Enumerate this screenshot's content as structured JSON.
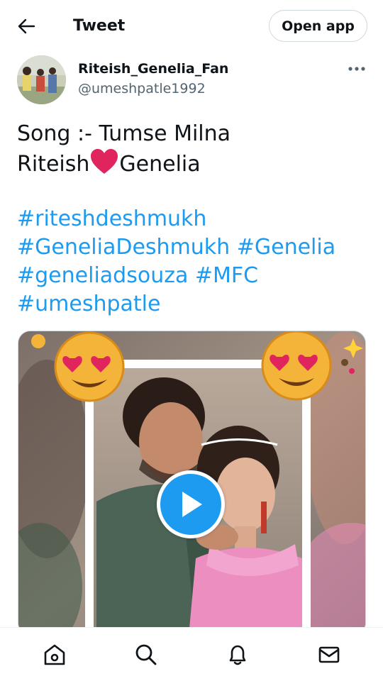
{
  "header": {
    "title": "Tweet",
    "back_icon": "arrow-left-icon",
    "open_app_label": "Open app"
  },
  "author": {
    "display_name": "Riteish_Genelia_Fan",
    "handle": "@umeshpatle1992",
    "more_icon": "more-horizontal-icon"
  },
  "tweet": {
    "line1": "Song :- Tumse Milna",
    "line2_before": "Riteish",
    "line2_emoji": "red-heart-emoji",
    "line2_after": "Genelia",
    "hashtags": [
      [
        "#riteshdeshmukh"
      ],
      [
        "#GeneliaDeshmukh",
        "#Genelia"
      ],
      [
        "#geneliadsouza",
        "#MFC"
      ],
      [
        "#umeshpatle"
      ]
    ]
  },
  "media": {
    "type": "video",
    "play_icon": "play-icon",
    "decorations": [
      "heart-eyes-emoji",
      "heart-eyes-emoji"
    ]
  },
  "bottom_nav": {
    "items": [
      {
        "name": "home",
        "icon": "home-icon"
      },
      {
        "name": "search",
        "icon": "search-icon"
      },
      {
        "name": "notifications",
        "icon": "bell-icon"
      },
      {
        "name": "messages",
        "icon": "mail-icon"
      }
    ]
  },
  "colors": {
    "accent": "#1d9bf0",
    "text_primary": "#0f1419",
    "text_secondary": "#536471",
    "border": "#cfd9de",
    "heart": "#e0245e"
  }
}
